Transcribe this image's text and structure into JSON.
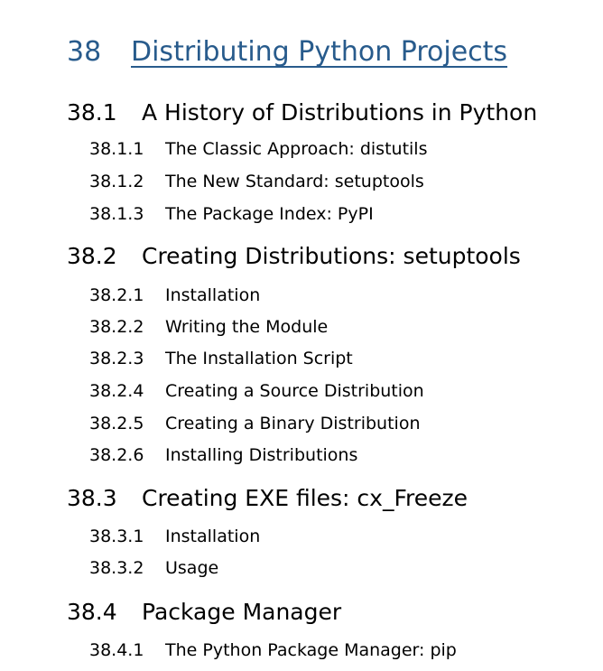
{
  "chapter": {
    "number": "38",
    "title": "Distributing Python Projects",
    "color": "#285b8c"
  },
  "sections": [
    {
      "number": "38.1",
      "title": "A History of Distributions in Python",
      "subsections": [
        {
          "number": "38.1.1",
          "title": "The Classic Approach: distutils"
        },
        {
          "number": "38.1.2",
          "title": "The New Standard: setuptools"
        },
        {
          "number": "38.1.3",
          "title": "The Package Index: PyPI"
        }
      ]
    },
    {
      "number": "38.2",
      "title": "Creating Distributions: setuptools",
      "subsections": [
        {
          "number": "38.2.1",
          "title": "Installation"
        },
        {
          "number": "38.2.2",
          "title": "Writing the Module"
        },
        {
          "number": "38.2.3",
          "title": "The Installation Script"
        },
        {
          "number": "38.2.4",
          "title": "Creating a Source Distribution"
        },
        {
          "number": "38.2.5",
          "title": "Creating a Binary Distribution"
        },
        {
          "number": "38.2.6",
          "title": "Installing Distributions"
        }
      ]
    },
    {
      "number": "38.3",
      "title": "Creating EXE files: cx_Freeze",
      "subsections": [
        {
          "number": "38.3.1",
          "title": "Installation"
        },
        {
          "number": "38.3.2",
          "title": "Usage"
        }
      ]
    },
    {
      "number": "38.4",
      "title": "Package Manager",
      "subsections": [
        {
          "number": "38.4.1",
          "title": "The Python Package Manager: pip"
        }
      ]
    }
  ]
}
